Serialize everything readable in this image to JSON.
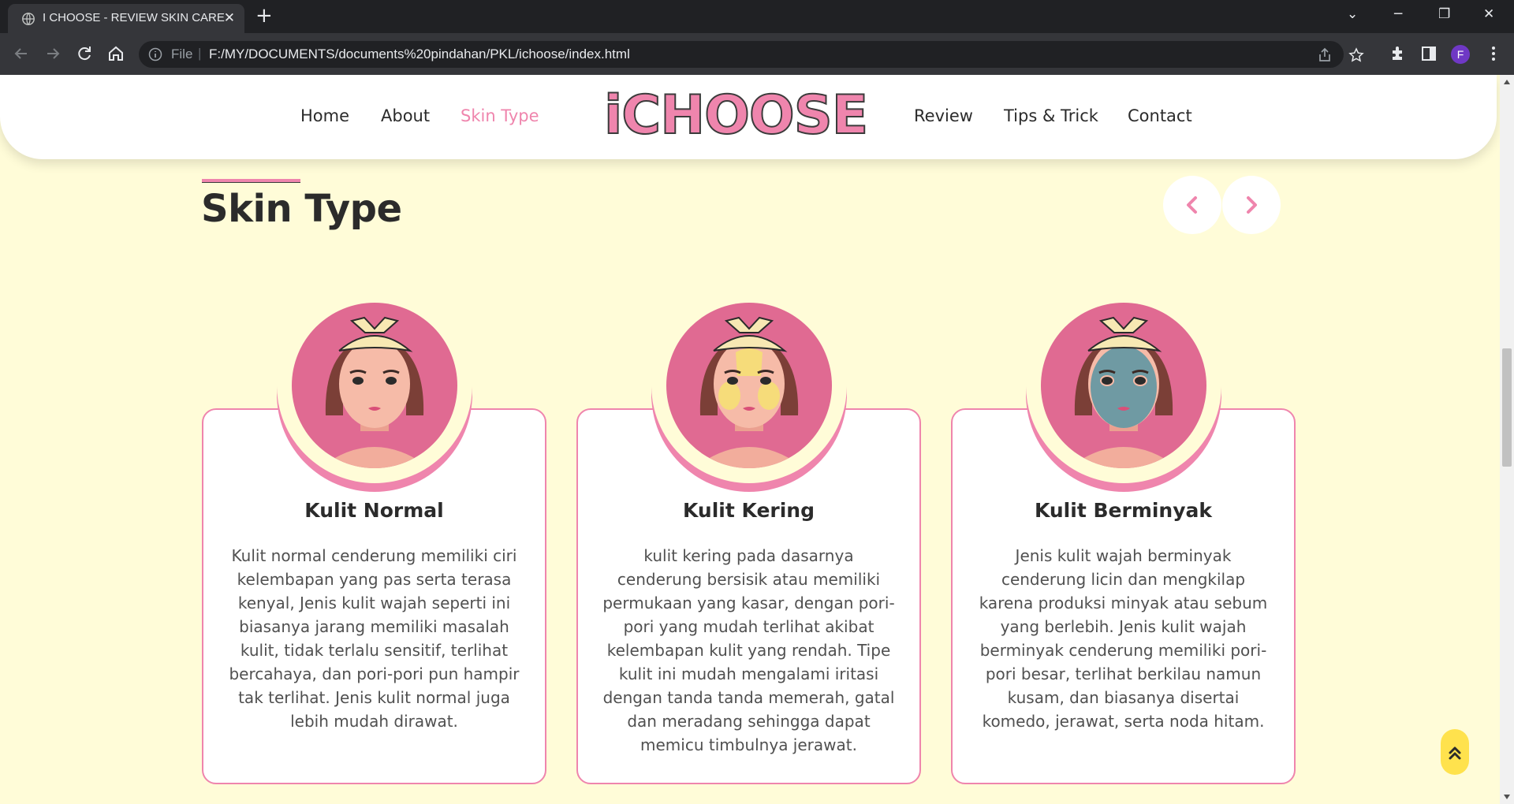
{
  "browser": {
    "tab_title": "I CHOOSE - REVIEW SKIN CARE",
    "new_tab": "+",
    "address_prefix": "File",
    "url": "F:/MY/DOCUMENTS/documents%20pindahan/PKL/ichoose/index.html",
    "profile_initial": "F"
  },
  "nav": {
    "left": [
      "Home",
      "About",
      "Skin Type"
    ],
    "logo": "iCHOOSE",
    "right": [
      "Review",
      "Tips & Trick",
      "Contact"
    ],
    "active": "Skin Type"
  },
  "section": {
    "title": "Skin Type"
  },
  "cards": [
    {
      "title": "Kulit Normal",
      "text": "Kulit normal cenderung memiliki ciri kelembapan yang pas serta terasa kenyal, Jenis kulit wajah seperti ini biasanya jarang memiliki masalah kulit, tidak terlalu sensitif, terlihat bercahaya, dan pori-pori pun hampir tak terlihat. Jenis kulit normal juga lebih mudah dirawat."
    },
    {
      "title": "Kulit Kering",
      "text": "kulit kering pada dasarnya cenderung bersisik atau memiliki permukaan yang kasar, dengan pori-pori yang mudah terlihat akibat kelembapan kulit yang rendah. Tipe kulit ini mudah mengalami iritasi dengan tanda tanda memerah, gatal dan meradang sehingga dapat memicu timbulnya jerawat."
    },
    {
      "title": "Kulit Berminyak",
      "text": "Jenis kulit wajah berminyak cenderung licin dan mengkilap karena produksi minyak atau sebum yang berlebih. Jenis kulit wajah berminyak cenderung memiliki pori-pori besar, terlihat berkilau namun kusam, dan biasanya disertai komedo, jerawat, serta noda hitam."
    }
  ],
  "colors": {
    "accent_pink": "#ef85ad",
    "background": "#fffcd8",
    "scroll_top": "#ffe24d",
    "avatar_bg": "#e06a92"
  }
}
